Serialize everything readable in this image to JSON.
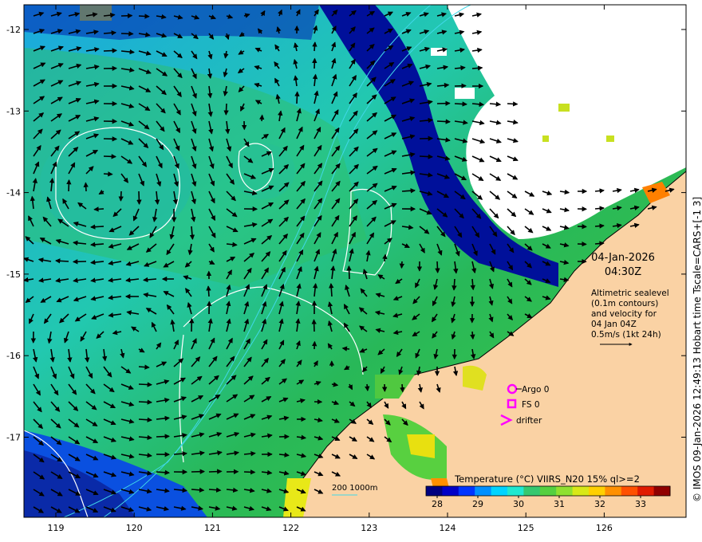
{
  "map": {
    "date": "04-Jan-2026",
    "time": "04:30Z",
    "info_lines": [
      "Altimetric sealevel",
      "(0.1m contours)",
      "and velocity for",
      "04 Jan 04Z",
      "0.5m/s (1kt 24h)"
    ],
    "credit": "© IMOS 09-Jan-2026 12:49:13 Hobart time Tscale=CARS+[-1 3]",
    "bathymetry_label": "200  1000m",
    "legend": {
      "argo": "Argo 0",
      "fs": "FS 0",
      "drifter": "drifter"
    },
    "colorbar": {
      "title": "Temperature (°C) VIIRS_N20 15% ql>=2",
      "ticks": [
        "28",
        "29",
        "30",
        "31",
        "32",
        "33"
      ],
      "colors": [
        "#00007f",
        "#0000c8",
        "#0035ff",
        "#0090ff",
        "#00d4ff",
        "#20e8d0",
        "#35c870",
        "#55d040",
        "#90e030",
        "#d8e818",
        "#ffd000",
        "#ff9000",
        "#ff5000",
        "#e01a00",
        "#900000"
      ]
    },
    "lat_ticks": [
      "-12",
      "-13",
      "-14",
      "-15",
      "-16",
      "-17"
    ],
    "lon_ticks": [
      "119",
      "120",
      "121",
      "122",
      "123",
      "124",
      "125",
      "126"
    ],
    "colors": {
      "land": "#fad2a4",
      "cloud": "#ffffff",
      "contour": "#ffffff",
      "bathymetry": "#40d8e8",
      "marker": "#ff00ff"
    }
  }
}
